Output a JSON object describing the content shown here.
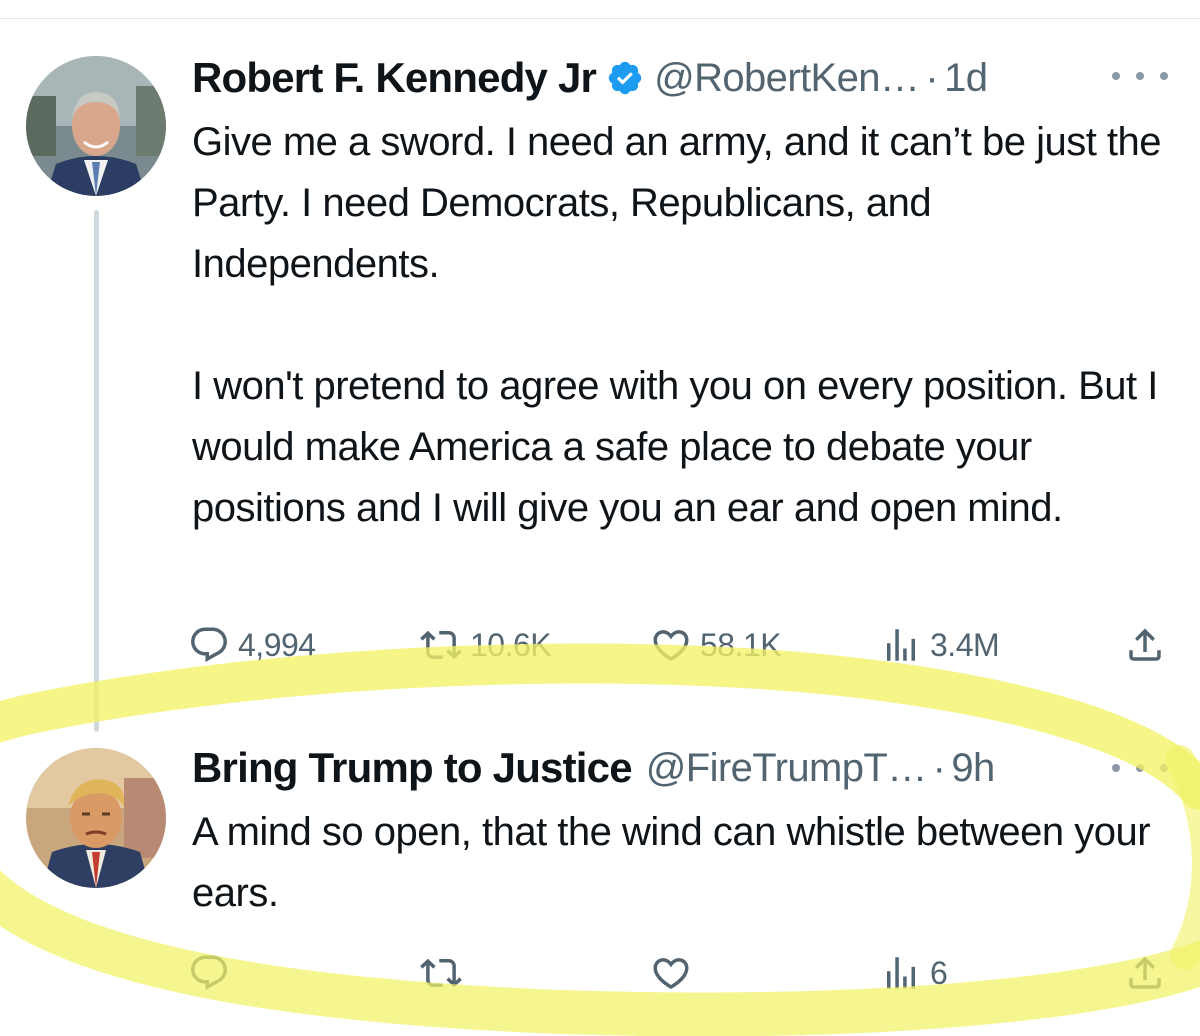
{
  "tweets": [
    {
      "name": "Robert F. Kennedy Jr",
      "verified": true,
      "handle": "@RobertKen…",
      "separator": "·",
      "time": "1d",
      "paragraphs": [
        "Give me a sword. I need an army, and it can’t be just the Party. I need Democrats, Republicans, and Independents.",
        "I won't pretend to agree with you on every position. But I would make America a safe place to debate your positions and I will give you an ear and open mind."
      ],
      "stats": {
        "replies": "4,994",
        "reposts": "10.6K",
        "likes": "58.1K",
        "views": "3.4M"
      }
    },
    {
      "name": "Bring Trump to Justice",
      "verified": false,
      "handle": "@FireTrumpT…",
      "separator": "·",
      "time": "9h",
      "paragraphs": [
        "A mind so open, that the wind can whistle between your ears."
      ],
      "stats": {
        "replies": "",
        "reposts": "",
        "likes": "",
        "views": "6"
      }
    }
  ],
  "icons": [
    "reply-icon",
    "repost-icon",
    "like-icon",
    "views-icon",
    "share-icon",
    "more-icon",
    "verified-badge-icon"
  ],
  "colors": {
    "text": "#0f1419",
    "secondary": "#536471",
    "verified": "#1d9bf0",
    "highlighter": "#f2f266",
    "thread_line": "#cfd9de"
  }
}
